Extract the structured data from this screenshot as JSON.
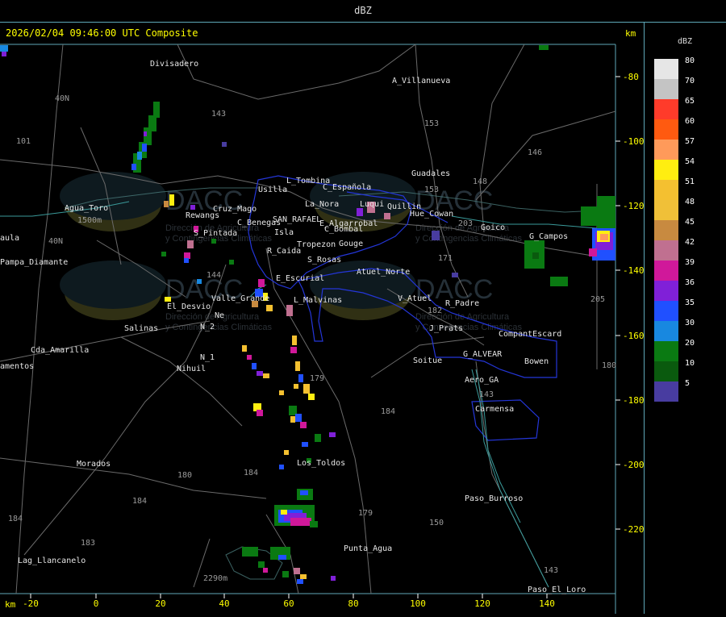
{
  "header": {
    "title": "dBZ"
  },
  "map": {
    "timestamp": "2026/02/04 09:46:00 UTC Composite",
    "unit_top": "km",
    "unit_bottom": "km",
    "x_ticks": [
      "-20",
      "0",
      "20",
      "40",
      "60",
      "80",
      "100",
      "120",
      "140"
    ],
    "y_ticks": [
      "-80",
      "-100",
      "-120",
      "-140",
      "-160",
      "-180",
      "-200",
      "-220"
    ],
    "places": [
      {
        "name": "Divisadero"
      },
      {
        "name": "A_Villanueva"
      },
      {
        "name": "40N"
      },
      {
        "name": "101"
      },
      {
        "name": "143"
      },
      {
        "name": "153"
      },
      {
        "name": "146"
      },
      {
        "name": "Guadales"
      },
      {
        "name": "148"
      },
      {
        "name": "153"
      },
      {
        "name": "L_Tombina"
      },
      {
        "name": "C_Española"
      },
      {
        "name": "Usilla"
      },
      {
        "name": "La_Nora"
      },
      {
        "name": "Agua_Toro"
      },
      {
        "name": "1500m"
      },
      {
        "name": "Rewangs"
      },
      {
        "name": "Cruz_Mago"
      },
      {
        "name": "C_Benegas"
      },
      {
        "name": "SAN_RAFAEL"
      },
      {
        "name": "E_Algarrobal"
      },
      {
        "name": "Luqui"
      },
      {
        "name": "Quillin"
      },
      {
        "name": "Hue_Cowan"
      },
      {
        "name": "203"
      },
      {
        "name": "Goico"
      },
      {
        "name": "G_Campos"
      },
      {
        "name": "C_Bombal"
      },
      {
        "name": "Isla"
      },
      {
        "name": "Gouge"
      },
      {
        "name": "S_Pintada"
      },
      {
        "name": "Tropezon"
      },
      {
        "name": "R_Caida"
      },
      {
        "name": "S_Rosas"
      },
      {
        "name": "171"
      },
      {
        "name": "Pampa_Diamante"
      },
      {
        "name": "aula"
      },
      {
        "name": "40N"
      },
      {
        "name": "Atuel_Norte"
      },
      {
        "name": "E_Escurial"
      },
      {
        "name": "144"
      },
      {
        "name": "Valle_Grande"
      },
      {
        "name": "L_Malvinas"
      },
      {
        "name": "V_Atuel"
      },
      {
        "name": "R_Padre"
      },
      {
        "name": "El_Desvio"
      },
      {
        "name": "Ne"
      },
      {
        "name": "182"
      },
      {
        "name": "205"
      },
      {
        "name": "Salinas"
      },
      {
        "name": "N_2"
      },
      {
        "name": "J_Prats"
      },
      {
        "name": "CompantEscard"
      },
      {
        "name": "Cda_Amarilla"
      },
      {
        "name": "N_1"
      },
      {
        "name": "G_ALVEAR"
      },
      {
        "name": "Soitue"
      },
      {
        "name": "Bowen"
      },
      {
        "name": "amentos"
      },
      {
        "name": "Nihuil"
      },
      {
        "name": "179"
      },
      {
        "name": "Aero_GA"
      },
      {
        "name": "143"
      },
      {
        "name": "184"
      },
      {
        "name": "Carmensa"
      },
      {
        "name": "Morados"
      },
      {
        "name": "Los_Toldos"
      },
      {
        "name": "180"
      },
      {
        "name": "184"
      },
      {
        "name": "184"
      },
      {
        "name": "Paso_Burroso"
      },
      {
        "name": "184"
      },
      {
        "name": "179"
      },
      {
        "name": "150"
      },
      {
        "name": "183"
      },
      {
        "name": "Lag_Llancanelo"
      },
      {
        "name": "Punta_Agua"
      },
      {
        "name": "2290m"
      },
      {
        "name": "143"
      },
      {
        "name": "Paso_El_Loro"
      },
      {
        "name": "180"
      }
    ],
    "watermark": {
      "logo": "DACC",
      "line1": "Dirección de Agricultura",
      "line2": "y Contingencias Climáticas"
    }
  },
  "legend": {
    "title": "dBZ",
    "levels": [
      {
        "value": "80",
        "color": "#e6e6e6"
      },
      {
        "value": "70",
        "color": "#c4c4c4"
      },
      {
        "value": "65",
        "color": "#ff3b2a"
      },
      {
        "value": "60",
        "color": "#ff5a10"
      },
      {
        "value": "57",
        "color": "#ff9a5a"
      },
      {
        "value": "54",
        "color": "#ffee10"
      },
      {
        "value": "51",
        "color": "#f4c030"
      },
      {
        "value": "48",
        "color": "#f0c038"
      },
      {
        "value": "45",
        "color": "#c88a40"
      },
      {
        "value": "42",
        "color": "#c07090"
      },
      {
        "value": "39",
        "color": "#d0189a"
      },
      {
        "value": "36",
        "color": "#8020d8"
      },
      {
        "value": "35",
        "color": "#2050ff"
      },
      {
        "value": "30",
        "color": "#1888e0"
      },
      {
        "value": "20",
        "color": "#0a7a12"
      },
      {
        "value": "10",
        "color": "#0a5a0e"
      },
      {
        "value": "5",
        "color": "#483ca0"
      }
    ]
  }
}
